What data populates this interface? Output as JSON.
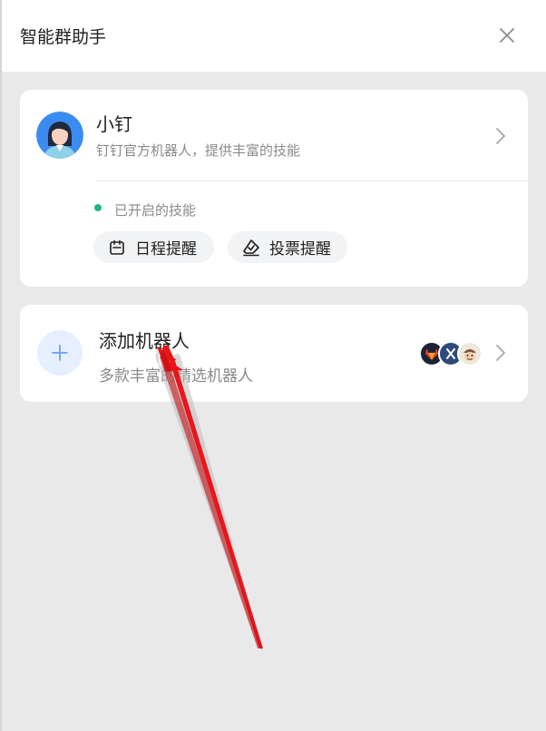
{
  "header": {
    "title": "智能群助手"
  },
  "bot_card": {
    "name": "小钉",
    "description": "钉钉官方机器人，提供丰富的技能",
    "skills_label": "已开启的技能",
    "skills": [
      {
        "label": "日程提醒",
        "icon": "calendar-icon"
      },
      {
        "label": "投票提醒",
        "icon": "vote-icon"
      }
    ]
  },
  "add_card": {
    "title": "添加机器人",
    "description": "多款丰富的精选机器人",
    "preview_bots": [
      "gitlab-bot-avatar",
      "jira-bot-avatar",
      "pirate-bot-avatar"
    ]
  },
  "colors": {
    "background": "#e9e9ea",
    "card": "#ffffff",
    "active_dot": "#1fb87d",
    "add_circle": "#e6efff",
    "annotation_arrow": "#e8161a"
  }
}
